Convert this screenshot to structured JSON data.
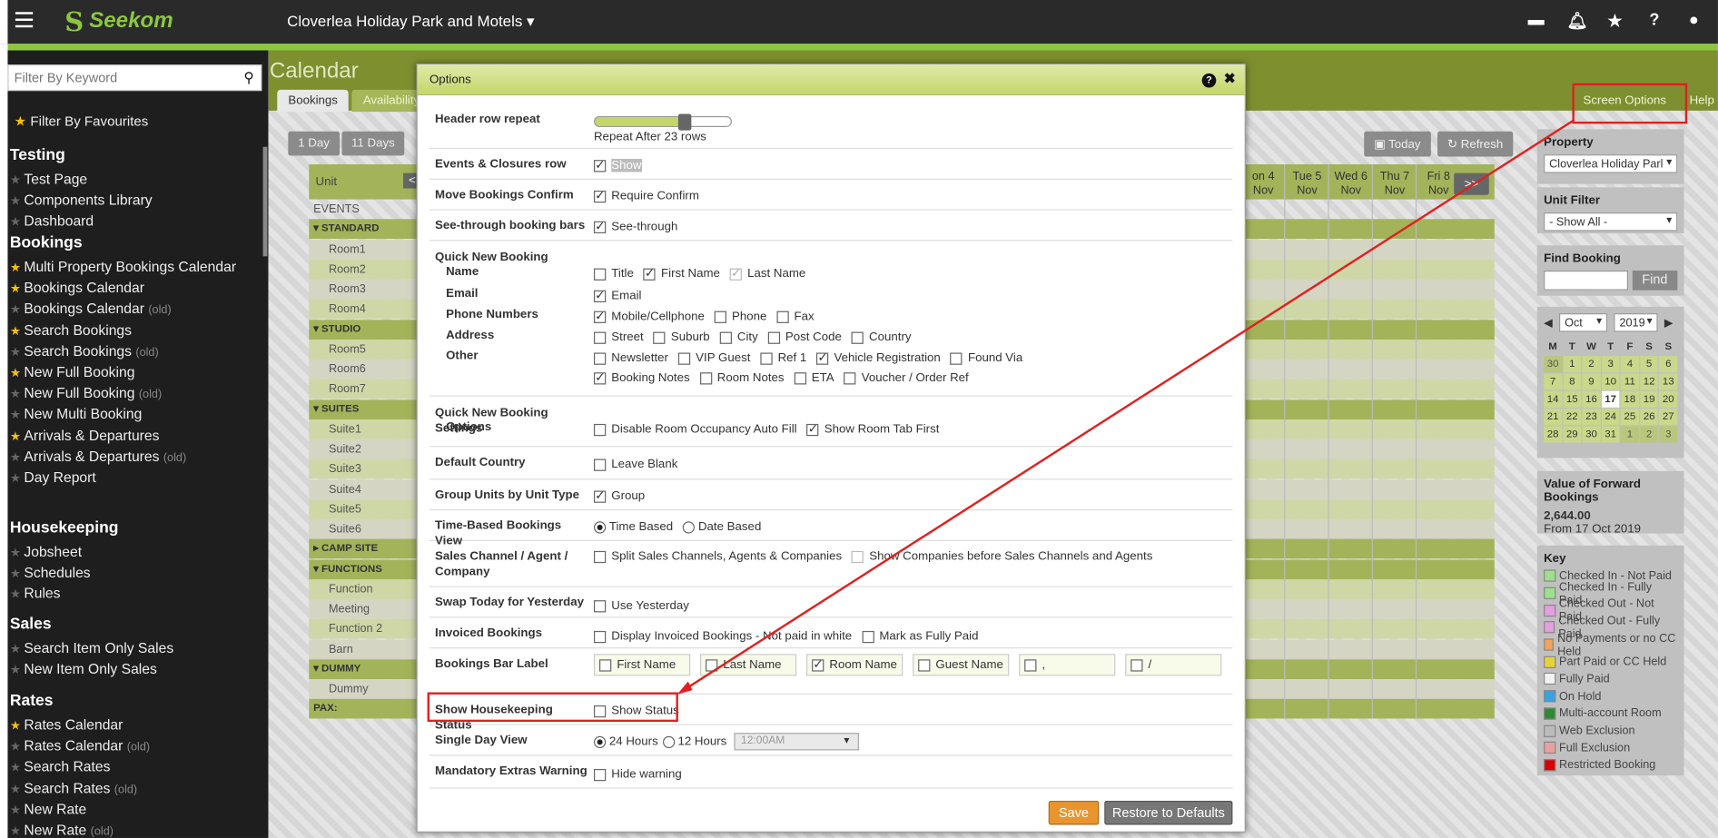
{
  "topbar": {
    "brand": "Seekom",
    "property": "Cloverlea Holiday Park and Motels",
    "caret": "▾"
  },
  "topicons": [
    "bed-icon",
    "bell-icon",
    "star-icon",
    "help-icon",
    "user-icon"
  ],
  "sidebar": {
    "search_placeholder": "Filter By Keyword",
    "fav": "Filter By Favourites",
    "groups": [
      {
        "title": "Testing",
        "items": [
          {
            "label": "Test Page",
            "fav": false
          },
          {
            "label": "Components Library",
            "fav": false
          },
          {
            "label": "Dashboard",
            "fav": false
          }
        ]
      },
      {
        "title": "Bookings",
        "items": [
          {
            "label": "Multi Property Bookings Calendar",
            "fav": true
          },
          {
            "label": "Bookings Calendar",
            "fav": true
          },
          {
            "label": "Bookings Calendar",
            "fav": false,
            "old": "(old)"
          },
          {
            "label": "Search Bookings",
            "fav": true
          },
          {
            "label": "Search Bookings",
            "fav": false,
            "old": "(old)"
          },
          {
            "label": "New Full Booking",
            "fav": true
          },
          {
            "label": "New Full Booking",
            "fav": false,
            "old": "(old)"
          },
          {
            "label": "New Multi Booking",
            "fav": false
          },
          {
            "label": "Arrivals & Departures",
            "fav": true
          },
          {
            "label": "Arrivals & Departures",
            "fav": false,
            "old": "(old)"
          },
          {
            "label": "Day Report",
            "fav": false
          }
        ]
      },
      {
        "title": "Housekeeping",
        "items": [
          {
            "label": "Jobsheet",
            "fav": false
          },
          {
            "label": "Schedules",
            "fav": false
          },
          {
            "label": "Rules",
            "fav": false
          }
        ]
      },
      {
        "title": "Sales",
        "items": [
          {
            "label": "Search Item Only Sales",
            "fav": false
          },
          {
            "label": "New Item Only Sales",
            "fav": false
          }
        ]
      },
      {
        "title": "Rates",
        "items": [
          {
            "label": "Rates Calendar",
            "fav": true
          },
          {
            "label": "Rates Calendar",
            "fav": false,
            "old": "(old)"
          },
          {
            "label": "Search Rates",
            "fav": false
          },
          {
            "label": "Search Rates",
            "fav": false,
            "old": "(old)"
          },
          {
            "label": "New Rate",
            "fav": false
          },
          {
            "label": "New Rate",
            "fav": false,
            "old": "(old)"
          }
        ]
      }
    ]
  },
  "calendar": {
    "title": "Calendar",
    "tabs": [
      "Bookings",
      "Availability &"
    ],
    "screen_options": "Screen Options",
    "help": "Help",
    "range_buttons": [
      "1 Day",
      "11 Days"
    ],
    "today": "Today",
    "refresh": "Refresh",
    "unit_header": "Unit",
    "prev": "<",
    "next": ">>",
    "days": [
      [
        "on 4",
        "Nov"
      ],
      [
        "Tue 5",
        "Nov"
      ],
      [
        "Wed 6",
        "Nov"
      ],
      [
        "Thu 7",
        "Nov"
      ],
      [
        "Fri 8",
        "Nov"
      ]
    ],
    "rows": [
      {
        "type": "label",
        "text": "EVENTS"
      },
      {
        "type": "sec",
        "text": "▾ STANDARD"
      },
      {
        "type": "unit",
        "text": "Room1"
      },
      {
        "type": "unit",
        "text": "Room2"
      },
      {
        "type": "unit",
        "text": "Room3"
      },
      {
        "type": "unit",
        "text": "Room4"
      },
      {
        "type": "sec",
        "text": "▾ STUDIO"
      },
      {
        "type": "unit",
        "text": "Room5"
      },
      {
        "type": "unit",
        "text": "Room6"
      },
      {
        "type": "unit",
        "text": "Room7"
      },
      {
        "type": "sec",
        "text": "▾ SUITES"
      },
      {
        "type": "unit",
        "text": "Suite1"
      },
      {
        "type": "unit",
        "text": "Suite2"
      },
      {
        "type": "unit",
        "text": "Suite3"
      },
      {
        "type": "unit",
        "text": "Suite4"
      },
      {
        "type": "unit",
        "text": "Suite5"
      },
      {
        "type": "unit",
        "text": "Suite6"
      },
      {
        "type": "sec",
        "text": "▸ CAMP SITE"
      },
      {
        "type": "sec",
        "text": "▾ FUNCTIONS"
      },
      {
        "type": "unit",
        "text": "Function"
      },
      {
        "type": "unit",
        "text": "Meeting"
      },
      {
        "type": "unit",
        "text": "Function 2"
      },
      {
        "type": "unit",
        "text": "Barn"
      },
      {
        "type": "sec",
        "text": "▾ DUMMY"
      },
      {
        "type": "unit",
        "text": "Dummy"
      },
      {
        "type": "sec",
        "text": "PAX:"
      }
    ]
  },
  "right": {
    "property_label": "Property",
    "property_value": "Cloverlea Holiday Parl",
    "unit_filter_label": "Unit Filter",
    "unit_filter_value": "- Show All -",
    "find_label": "Find Booking",
    "find_button": "Find",
    "month": "Oct",
    "year": "2019",
    "dow": [
      "M",
      "T",
      "W",
      "T",
      "F",
      "S",
      "S"
    ],
    "weeks": [
      [
        "30",
        "1",
        "2",
        "3",
        "4",
        "5",
        "6"
      ],
      [
        "7",
        "8",
        "9",
        "10",
        "11",
        "12",
        "13"
      ],
      [
        "14",
        "15",
        "16",
        "17",
        "18",
        "19",
        "20"
      ],
      [
        "21",
        "22",
        "23",
        "24",
        "25",
        "26",
        "27"
      ],
      [
        "28",
        "29",
        "30",
        "31",
        "1",
        "2",
        "3"
      ]
    ],
    "today": "17",
    "fwd_label": "Value of Forward Bookings",
    "fwd_value": "2,644.00",
    "fwd_from": "From 17 Oct 2019",
    "key_label": "Key",
    "keys": [
      {
        "label": "Checked In - Not Paid",
        "color": "#9ee08c"
      },
      {
        "label": "Checked In - Fully Paid",
        "color": "#9ee08c"
      },
      {
        "label": "Checked Out - Not Paid",
        "color": "#e59ee0"
      },
      {
        "label": "Checked Out - Fully Paid",
        "color": "#e59ee0"
      },
      {
        "label": "No Payments or no CC Held",
        "color": "#f0a35e"
      },
      {
        "label": "Part Paid or CC Held",
        "color": "#e8d23a"
      },
      {
        "label": "Fully Paid",
        "color": "#f2f2f2"
      },
      {
        "label": "On Hold",
        "color": "#3ba0e0"
      },
      {
        "label": "Multi-account Room",
        "color": "#2e8a2e"
      },
      {
        "label": "Web Exclusion",
        "color": "#bbbbbb"
      },
      {
        "label": "Full Exclusion",
        "color": "#e9a0a0"
      },
      {
        "label": "Restricted Booking",
        "color": "#d80000"
      }
    ]
  },
  "modal": {
    "title": "Options",
    "help": "?",
    "close": "✖",
    "header_repeat_label": "Header row repeat",
    "header_repeat_value": "Repeat After 23 rows",
    "rows": [
      {
        "label": "Events & Closures row",
        "options": [
          {
            "t": "Show",
            "on": true,
            "hl": true
          }
        ]
      },
      {
        "label": "Move Bookings Confirm",
        "options": [
          {
            "t": "Require Confirm",
            "on": true
          }
        ]
      },
      {
        "label": "See-through booking bars",
        "options": [
          {
            "t": "See-through",
            "on": true
          }
        ]
      }
    ],
    "qnb_label": "Quick New Booking",
    "qnb": [
      {
        "sub": "Name",
        "options": [
          {
            "t": "Title",
            "on": false
          },
          {
            "t": "First Name",
            "on": true
          },
          {
            "t": "Last Name",
            "on": true,
            "dis": true
          }
        ]
      },
      {
        "sub": "Email",
        "options": [
          {
            "t": "Email",
            "on": true
          }
        ]
      },
      {
        "sub": "Phone Numbers",
        "options": [
          {
            "t": "Mobile/Cellphone",
            "on": true
          },
          {
            "t": "Phone",
            "on": false
          },
          {
            "t": "Fax",
            "on": false
          }
        ]
      },
      {
        "sub": "Address",
        "options": [
          {
            "t": "Street",
            "on": false
          },
          {
            "t": "Suburb",
            "on": false
          },
          {
            "t": "City",
            "on": false
          },
          {
            "t": "Post Code",
            "on": false
          },
          {
            "t": "Country",
            "on": false
          }
        ]
      },
      {
        "sub": "Other",
        "options": [
          {
            "t": "Newsletter",
            "on": false
          },
          {
            "t": "VIP Guest",
            "on": false
          },
          {
            "t": "Ref 1",
            "on": false
          },
          {
            "t": "Vehicle Registration",
            "on": true
          },
          {
            "t": "Found Via",
            "on": false
          }
        ]
      },
      {
        "sub": "",
        "options": [
          {
            "t": "Booking Notes",
            "on": true
          },
          {
            "t": "Room Notes",
            "on": false
          },
          {
            "t": "ETA",
            "on": false
          },
          {
            "t": "Voucher / Order Ref",
            "on": false
          }
        ]
      }
    ],
    "qnbs_label": "Quick New Booking Settings",
    "qnbs_sub": "Options",
    "qnbs_options": [
      {
        "t": "Disable Room Occupancy Auto Fill",
        "on": false
      },
      {
        "t": "Show Room Tab First",
        "on": true
      }
    ],
    "default_country_label": "Default Country",
    "default_country_opt": "Leave Blank",
    "group_units_label": "Group Units by Unit Type",
    "group_units_opt": "Group",
    "time_based_label": "Time-Based Bookings View",
    "time_based_opts": [
      "Time Based",
      "Date Based"
    ],
    "sales_channel_label": "Sales Channel / Agent / Company",
    "sales_channel_opts": [
      "Split Sales Channels, Agents & Companies",
      "Show Companies before Sales Channels and Agents"
    ],
    "swap_label": "Swap Today for Yesterday",
    "swap_opt": "Use Yesterday",
    "invoiced_label": "Invoiced Bookings",
    "invoiced_opts": [
      "Display Invoiced Bookings - Not paid in white",
      "Mark as Fully Paid"
    ],
    "bar_label": "Bookings Bar Label",
    "bar_opts": [
      {
        "t": "First Name",
        "on": false
      },
      {
        "t": "Last Name",
        "on": false
      },
      {
        "t": "Room Name",
        "on": true
      },
      {
        "t": "Guest Name",
        "on": false
      },
      {
        "t": ",",
        "on": false
      },
      {
        "t": "/",
        "on": false
      }
    ],
    "hk_label": "Show Housekeeping Status",
    "hk_opt": "Show Status",
    "single_day_label": "Single Day View",
    "single_day_opts": [
      "24 Hours",
      "12 Hours"
    ],
    "single_day_time": "12:00AM",
    "mand_label": "Mandatory Extras Warning",
    "mand_opt": "Hide warning",
    "save": "Save",
    "restore": "Restore to Defaults"
  },
  "colors": {
    "annotation": "#e02020",
    "brand_green": "#8cc63f"
  }
}
